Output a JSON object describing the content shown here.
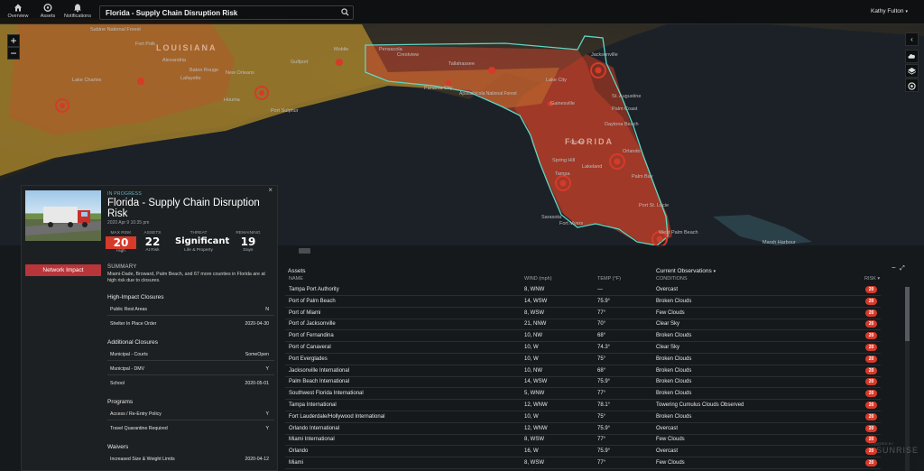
{
  "topbar": {
    "nav": [
      {
        "label": "Overview",
        "icon": "home-icon"
      },
      {
        "label": "Assets",
        "icon": "assets-icon"
      },
      {
        "label": "Notifications",
        "icon": "bell-icon"
      }
    ],
    "search_value": "Florida - Supply Chain Disruption Risk",
    "user_name": "Kathy Fulton"
  },
  "map": {
    "zoom_in": "+",
    "zoom_out": "−",
    "labels": {
      "louisiana": "LOUISIANA",
      "florida": "FLORIDA",
      "apalachicola": "Apalachicola National Forest"
    },
    "cities": [
      "Sabine National Forest",
      "Fort Polk",
      "Alexandria",
      "Baton Rouge",
      "Lafayette",
      "Lake Charles",
      "New Orleans",
      "Houma",
      "Port Sulphur",
      "Gulfport",
      "Mobile",
      "Pensacola",
      "Crestview",
      "Panama City",
      "Tallahassee",
      "Lake City",
      "Jacksonville",
      "St. Augustine",
      "Palm Coast",
      "Daytona Beach",
      "Ocala",
      "Gainesville",
      "Orlando",
      "Tampa",
      "Sarasota",
      "Spring Hill",
      "Lakeland",
      "Palm Bay",
      "Port St. Lucie",
      "Fort Myers",
      "West Palm Beach",
      "Marsh Harbour"
    ]
  },
  "detail": {
    "status": "IN PROGRESS",
    "title": "Florida - Supply Chain Disruption Risk",
    "date": "2020 Apr 9 10:35 pm",
    "stats": {
      "max_risk": {
        "label": "MAX RISK",
        "value": "20",
        "sub": "High"
      },
      "assets": {
        "label": "ASSETS",
        "value": "22",
        "sub": "At Risk"
      },
      "threat": {
        "label": "THREAT",
        "value": "Significant",
        "sub": "Life & Property"
      },
      "remaining": {
        "label": "REMAINING",
        "value": "19",
        "sub": "Days"
      }
    },
    "network_button": "Network Impact",
    "summary_heading": "SUMMARY",
    "summary_text": "Miami-Dade, Broward, Palm Beach, and 67 more counties in Florida are at high risk due to closures.",
    "sections": [
      {
        "heading": "High-Impact Closures",
        "rows": [
          {
            "label": "Public Rest Areas",
            "value": "N"
          },
          {
            "label": "Shelter In Place Order",
            "value": "2020-04-30"
          }
        ]
      },
      {
        "heading": "Additional Closures",
        "rows": [
          {
            "label": "Municipal - Courts",
            "value": "SomeOpen"
          },
          {
            "label": "Municipal - DMV",
            "value": "Y"
          },
          {
            "label": "School",
            "value": "2020-05-01"
          }
        ]
      },
      {
        "heading": "Programs",
        "rows": [
          {
            "label": "Access / Re-Entry Policy",
            "value": "Y"
          },
          {
            "label": "Travel Quarantine Required",
            "value": "Y"
          }
        ]
      },
      {
        "heading": "Waivers",
        "rows": [
          {
            "label": "Increased Size & Weight Limits",
            "value": "2020-04-12"
          }
        ]
      }
    ]
  },
  "assets_table": {
    "title": "Assets",
    "observations_title": "Current Observations",
    "headers": {
      "name": "NAME",
      "wind": "WIND (mph)",
      "temp": "TEMP (°F)",
      "conditions": "CONDITIONS",
      "risk": "RISK"
    },
    "rows": [
      {
        "name": "Tampa Port Authority",
        "wind": "8, WNW",
        "temp": "—",
        "conditions": "Overcast",
        "risk": "20"
      },
      {
        "name": "Port of Palm Beach",
        "wind": "14, WSW",
        "temp": "75.9°",
        "conditions": "Broken Clouds",
        "risk": "20"
      },
      {
        "name": "Port of Miami",
        "wind": "8, WSW",
        "temp": "77°",
        "conditions": "Few Clouds",
        "risk": "20"
      },
      {
        "name": "Port of Jacksonville",
        "wind": "21, NNW",
        "temp": "70°",
        "conditions": "Clear Sky",
        "risk": "20"
      },
      {
        "name": "Port of Fernandina",
        "wind": "10, NW",
        "temp": "68°",
        "conditions": "Broken Clouds",
        "risk": "20"
      },
      {
        "name": "Port of Canaveral",
        "wind": "10, W",
        "temp": "74.3°",
        "conditions": "Clear Sky",
        "risk": "20"
      },
      {
        "name": "Port Everglades",
        "wind": "10, W",
        "temp": "75°",
        "conditions": "Broken Clouds",
        "risk": "20"
      },
      {
        "name": "Jacksonville International",
        "wind": "10, NW",
        "temp": "68°",
        "conditions": "Broken Clouds",
        "risk": "20"
      },
      {
        "name": "Palm Beach International",
        "wind": "14, WSW",
        "temp": "75.9°",
        "conditions": "Broken Clouds",
        "risk": "20"
      },
      {
        "name": "Southwest Florida International",
        "wind": "5, WNW",
        "temp": "77°",
        "conditions": "Broken Clouds",
        "risk": "20"
      },
      {
        "name": "Tampa International",
        "wind": "12, WNW",
        "temp": "78.1°",
        "conditions": "Towering Cumulus Clouds Observed",
        "risk": "20"
      },
      {
        "name": "Fort Lauderdale/Hollywood International",
        "wind": "10, W",
        "temp": "75°",
        "conditions": "Broken Clouds",
        "risk": "20"
      },
      {
        "name": "Orlando International",
        "wind": "12, WNW",
        "temp": "75.9°",
        "conditions": "Overcast",
        "risk": "20"
      },
      {
        "name": "Miami International",
        "wind": "8, WSW",
        "temp": "77°",
        "conditions": "Few Clouds",
        "risk": "20"
      },
      {
        "name": "Orlando",
        "wind": "16, W",
        "temp": "75.9°",
        "conditions": "Overcast",
        "risk": "20"
      },
      {
        "name": "Miami",
        "wind": "8, WSW",
        "temp": "77°",
        "conditions": "Few Clouds",
        "risk": "20"
      }
    ]
  },
  "brand": {
    "name": "SUNRISE",
    "sub": "POWERED BY"
  },
  "colors": {
    "risk": "#d63a2a",
    "accent": "#62b6c9",
    "button": "#b8353a",
    "outline": "#5fd6c4"
  }
}
